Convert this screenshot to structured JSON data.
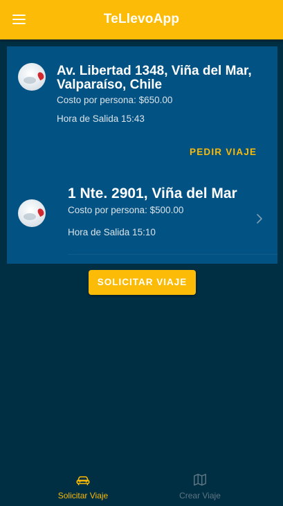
{
  "toolbar": {
    "title": "TeLlevoApp",
    "menu_icon": "menu-icon"
  },
  "trips": [
    {
      "address": "Av. Libertad 1348, Viña del Mar, Valparaíso, Chile",
      "address_line1": "Av. Libertad 1348, Viña del Mar,",
      "address_line2": "Valparaíso, Chile",
      "cost": "Costo por persona: $650.00",
      "departure": "Hora de Salida 15:43",
      "action_label": "PEDIR VIAJE",
      "avatar_icon": "location-pin-icon"
    },
    {
      "address": "1 Nte. 2901, Viña del Mar",
      "cost": "Costo por persona: $500.00",
      "departure": "Hora de Salida 15:10",
      "avatar_icon": "location-pin-icon",
      "chevron_icon": "chevron-right-icon"
    }
  ],
  "main_button": {
    "label": "SOLICITAR VIAJE"
  },
  "tabs": [
    {
      "label": "Solicitar Viaje",
      "icon": "car-icon",
      "active": true
    },
    {
      "label": "Crear Viaje",
      "icon": "map-icon",
      "active": false
    }
  ],
  "colors": {
    "primary": "#fcbb06",
    "background": "#002e42",
    "card": "#025283",
    "tab_inactive": "#5f7783"
  }
}
